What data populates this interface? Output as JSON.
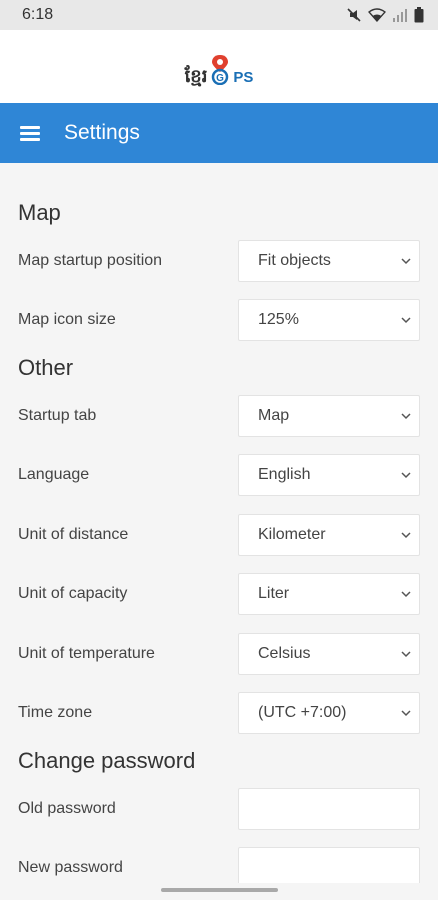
{
  "status_bar": {
    "time": "6:18",
    "icons": [
      "mute-icon",
      "wifi-icon",
      "signal-icon",
      "battery-icon"
    ]
  },
  "logo": {
    "khmer_text": "ខ្មែរ",
    "g_letter": "G",
    "ps_text": "PS"
  },
  "app_bar": {
    "title": "Settings",
    "background": "#2f86d6"
  },
  "sections": {
    "map": {
      "title": "Map",
      "startup_position": {
        "label": "Map startup position",
        "value": "Fit objects"
      },
      "icon_size": {
        "label": "Map icon size",
        "value": "125%"
      }
    },
    "other": {
      "title": "Other",
      "startup_tab": {
        "label": "Startup tab",
        "value": "Map"
      },
      "language": {
        "label": "Language",
        "value": "English"
      },
      "distance": {
        "label": "Unit of distance",
        "value": "Kilometer"
      },
      "capacity": {
        "label": "Unit of capacity",
        "value": "Liter"
      },
      "temperature": {
        "label": "Unit of temperature",
        "value": "Celsius"
      },
      "timezone": {
        "label": "Time zone",
        "value": "(UTC +7:00)"
      }
    },
    "password": {
      "title": "Change password",
      "old": {
        "label": "Old password",
        "value": ""
      },
      "new": {
        "label": "New password",
        "value": ""
      }
    }
  }
}
